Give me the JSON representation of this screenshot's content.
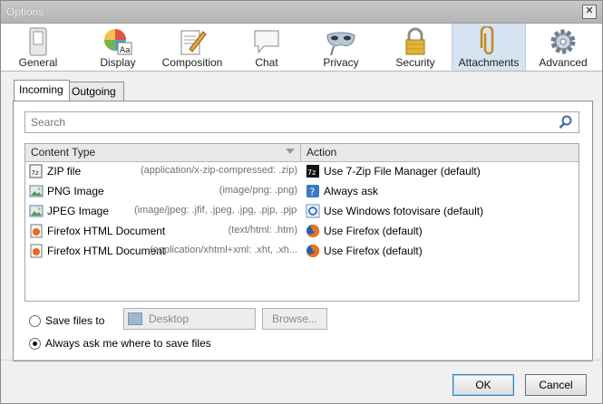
{
  "window": {
    "title": "Options",
    "close_glyph": "✕"
  },
  "toolbar": {
    "panes": [
      {
        "label": "General",
        "icon": "switch-icon"
      },
      {
        "label": "Display",
        "icon": "palette-icon"
      },
      {
        "label": "Composition",
        "icon": "compose-icon"
      },
      {
        "label": "Chat",
        "icon": "chat-icon"
      },
      {
        "label": "Privacy",
        "icon": "mask-icon"
      },
      {
        "label": "Security",
        "icon": "lock-icon"
      },
      {
        "label": "Attachments",
        "icon": "paperclip-icon",
        "selected": true
      },
      {
        "label": "Advanced",
        "icon": "gear-icon"
      }
    ]
  },
  "tabs": [
    {
      "label": "Incoming",
      "selected": true
    },
    {
      "label": "Outgoing",
      "selected": false
    }
  ],
  "search": {
    "placeholder": "Search"
  },
  "table": {
    "columns": [
      "Content Type",
      "Action"
    ],
    "rows": [
      {
        "type": "ZIP file",
        "mime": "(application/x-zip-compressed: .zip)",
        "type_icon": "zip-file-icon",
        "action": "Use 7-Zip File Manager (default)",
        "action_icon": "7zip-icon"
      },
      {
        "type": "PNG Image",
        "mime": "(image/png: .png)",
        "type_icon": "image-file-icon",
        "action": "Always ask",
        "action_icon": "ask-icon"
      },
      {
        "type": "JPEG Image",
        "mime": "(image/jpeg: .jfif, .jpeg, .jpg, .pjp, .pjpeg)",
        "type_icon": "image-file-icon",
        "action": "Use Windows fotovisare (default)",
        "action_icon": "photo-viewer-icon"
      },
      {
        "type": "Firefox HTML Document",
        "mime": "(text/html: .htm)",
        "type_icon": "html-file-icon",
        "action": "Use Firefox (default)",
        "action_icon": "firefox-icon"
      },
      {
        "type": "Firefox HTML Document",
        "mime": "(application/xhtml+xml: .xht, .xh...",
        "type_icon": "html-file-icon",
        "action": "Use Firefox (default)",
        "action_icon": "firefox-icon"
      }
    ]
  },
  "save": {
    "save_to_label": "Save files to",
    "folder": "Desktop",
    "browse_label": "Browse...",
    "always_ask_label": "Always ask me where to save files",
    "selected": "always_ask"
  },
  "buttons": {
    "ok": "OK",
    "cancel": "Cancel"
  }
}
